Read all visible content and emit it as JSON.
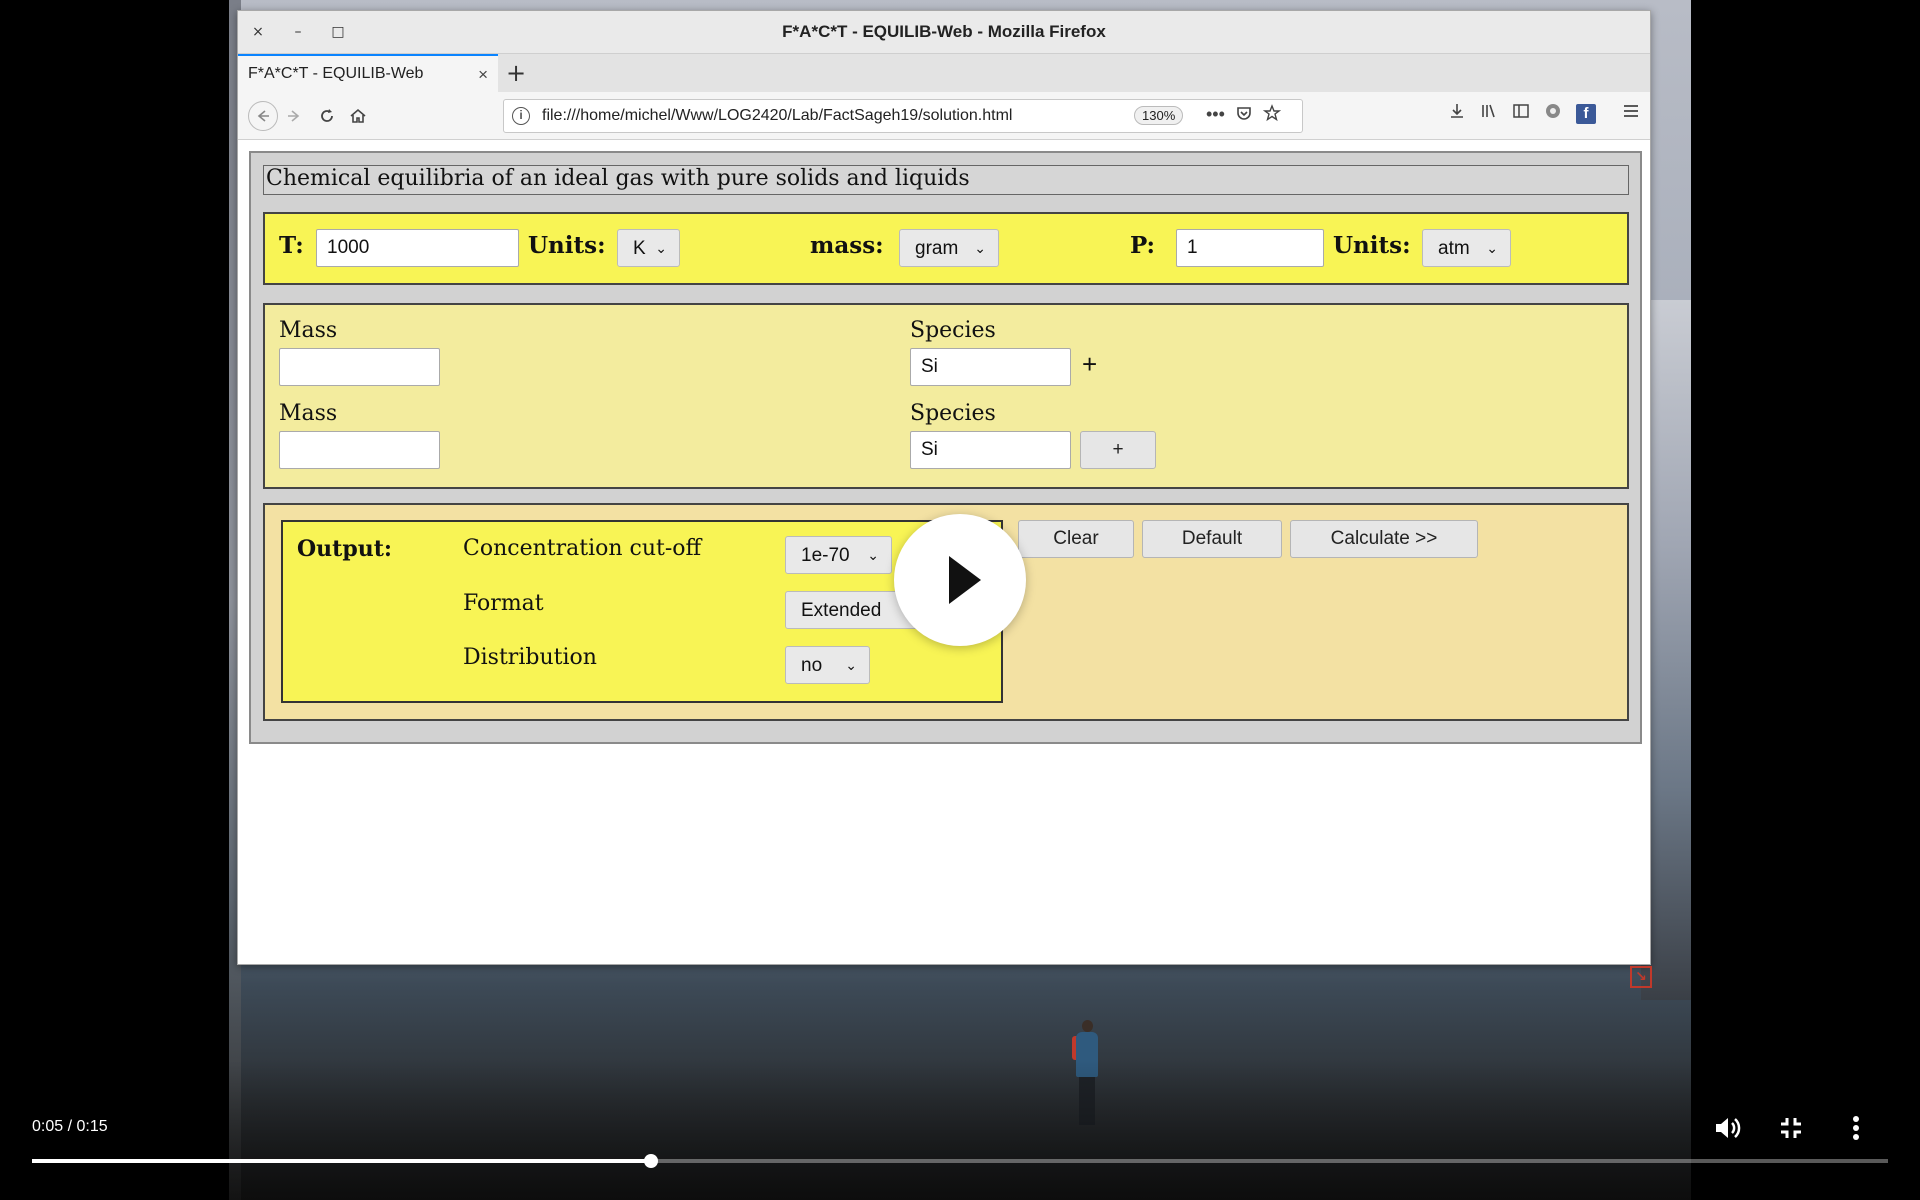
{
  "window": {
    "title": "F*A*C*T - EQUILIB-Web - Mozilla Firefox",
    "controls": {
      "close": "×",
      "minimize": "–",
      "maximize": "□"
    }
  },
  "tab": {
    "label": "F*A*C*T - EQUILIB-Web",
    "close": "×",
    "new_tab": "+"
  },
  "navbar": {
    "url": "file:///home/michel/Www/LOG2420/Lab/FactSageh19/solution.html",
    "zoom": "130%",
    "info": "i",
    "more": "•••"
  },
  "page": {
    "heading": "Chemical equilibria of an ideal gas with pure solids and liquids",
    "params": {
      "t_label": "T:",
      "t_value": "1000",
      "t_units_label": "Units:",
      "t_units_value": "K",
      "mass_label": "mass:",
      "mass_value": "gram",
      "p_label": "P:",
      "p_value": "1",
      "p_units_label": "Units:",
      "p_units_value": "atm"
    },
    "species_rows": [
      {
        "mass_label": "Mass",
        "mass_value": "",
        "species_label": "Species",
        "species_value": "Si",
        "plus": "+"
      },
      {
        "mass_label": "Mass",
        "mass_value": "",
        "species_label": "Species",
        "species_value": "Si",
        "plus": "+"
      }
    ],
    "output": {
      "label": "Output:",
      "cutoff_label": "Concentration cut-off",
      "cutoff_value": "1e-70",
      "format_label": "Format",
      "format_value": "Extended",
      "distribution_label": "Distribution",
      "distribution_value": "no"
    },
    "buttons": {
      "clear": "Clear",
      "default": "Default",
      "calculate": "Calculate >>"
    }
  },
  "video": {
    "time": "0:05 / 0:15",
    "progress_fraction": 0.3333,
    "icons": [
      "play-icon",
      "volume-icon",
      "exit-fullscreen-icon",
      "more-vert-icon"
    ]
  }
}
